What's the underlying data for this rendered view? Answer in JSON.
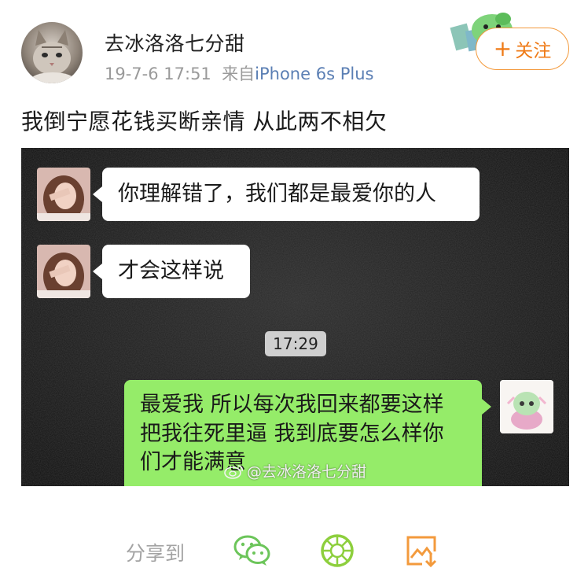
{
  "post": {
    "username": "去冰洛洛七分甜",
    "date": "19-7-6 17:51",
    "source_prefix": "来自",
    "source_device": "iPhone 6s Plus",
    "follow_label": "关注",
    "text": "我倒宁愿花钱买断亲情 从此两不相欠"
  },
  "chat": {
    "messages": [
      {
        "side": "left",
        "text": "你理解错了，我们都是最爱你的人"
      },
      {
        "side": "left",
        "text": "才会这样说"
      },
      {
        "side": "right",
        "lines": [
          "最爱我 所以每次我回来都要这样",
          "把我往死里逼 我到底要怎么样你",
          "们才能满意"
        ]
      }
    ],
    "timestamp": "17:29",
    "watermark": "@去冰洛洛七分甜"
  },
  "share": {
    "label": "分享到",
    "targets": [
      "wechat-icon",
      "moments-icon",
      "save-image-icon"
    ]
  },
  "colors": {
    "accent_orange": "#ef7a16",
    "link_blue": "#5b7fb4",
    "wechat_green": "#6cc55a",
    "bubble_green": "#95ec69",
    "chat_background": "#1c1c1c"
  }
}
